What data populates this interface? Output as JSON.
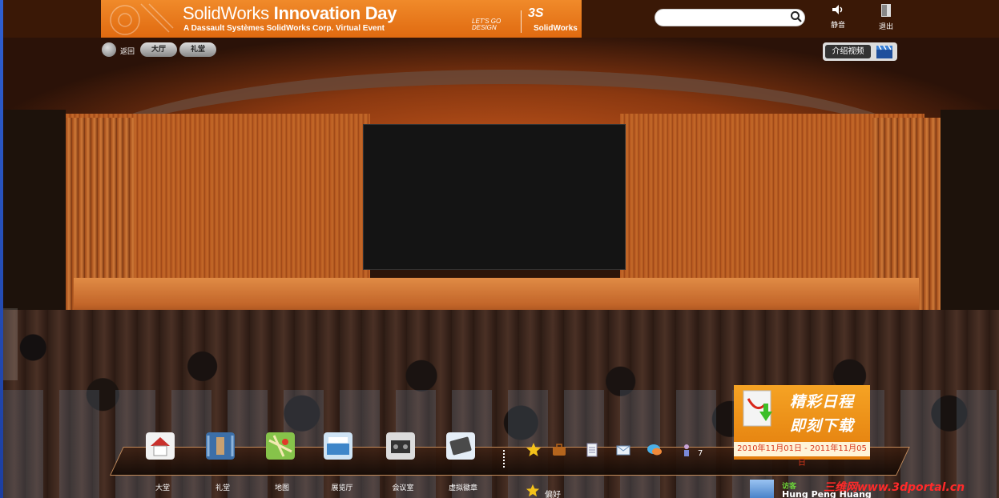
{
  "banner": {
    "title_regular": "SolidWorks ",
    "title_bold": "Innovation Day",
    "subtitle": "A Dassault Systèmes SolidWorks Corp. Virtual Event",
    "tagline": "LET'S GO DESIGN",
    "ds_mark": "3S",
    "brand": "SolidWorks"
  },
  "search": {
    "value": "",
    "placeholder": ""
  },
  "top_buttons": {
    "mute": "静音",
    "exit": "退出"
  },
  "nav": {
    "back": "返回",
    "hall": "大厅",
    "auditorium": "礼堂"
  },
  "intro_video": "介绍视频",
  "dock": {
    "items": [
      {
        "label": "大堂",
        "icon": "house-icon"
      },
      {
        "label": "礼堂",
        "icon": "auditorium-icon"
      },
      {
        "label": "地图",
        "icon": "map-icon"
      },
      {
        "label": "展览厅",
        "icon": "exhibit-hall-icon"
      },
      {
        "label": "会议室",
        "icon": "meeting-room-icon"
      },
      {
        "label": "虚拟徽章",
        "icon": "virtual-badge-icon"
      }
    ],
    "favorites_label": "偏好",
    "badge_count": "7"
  },
  "download_panel": {
    "line1": "精彩日程",
    "line2": "即刻下载",
    "date_range": "2010年11月01日 - 2011年11月05日"
  },
  "user": {
    "role": "访客",
    "name": "Hung Peng Huang"
  },
  "watermark": "三维网www.3dportal.cn",
  "colors": {
    "banner": "#e8741a",
    "accent": "#f5a324",
    "watermark": "#ff2a2a"
  }
}
